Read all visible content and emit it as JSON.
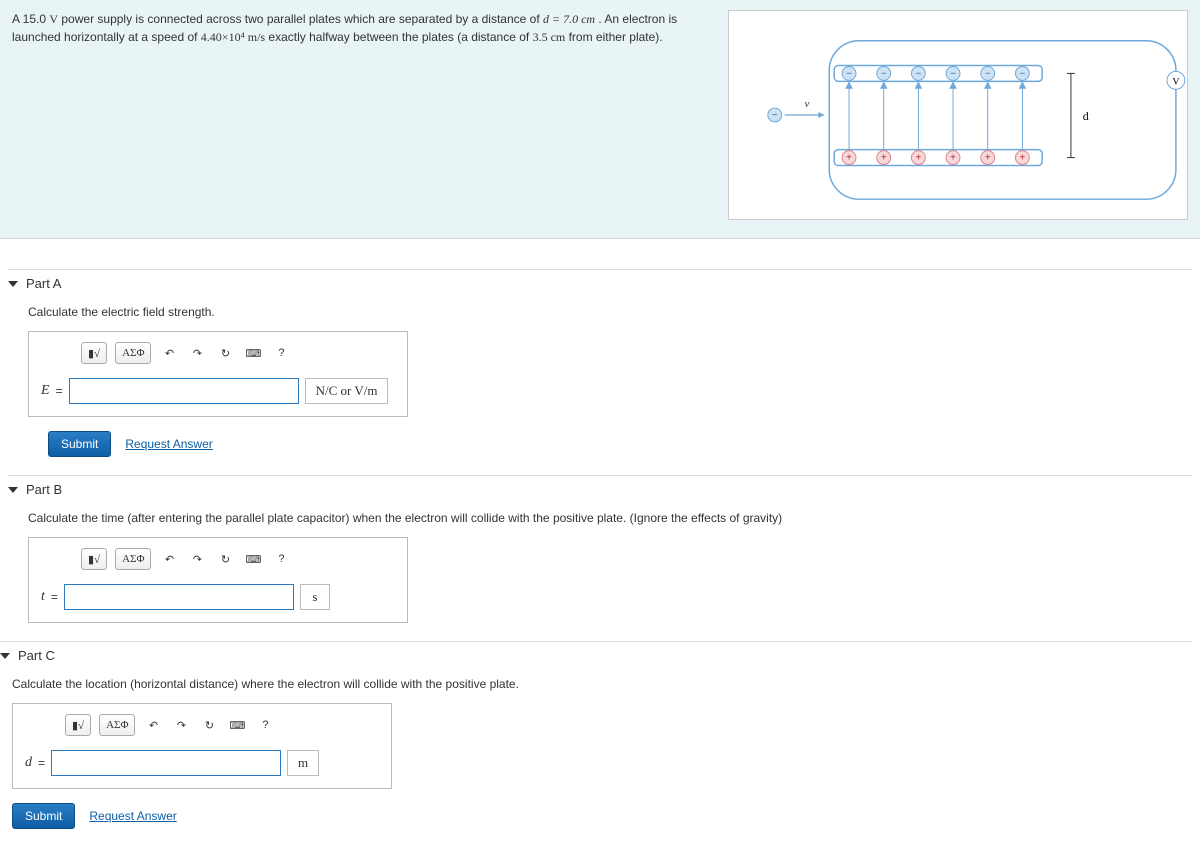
{
  "problem": {
    "text_prefix": "A 15.0 ",
    "unit_V": "V",
    "text_mid1": " power supply is connected across two parallel plates which are separated by a distance of ",
    "d_expr": "d = 7.0 cm",
    "text_mid2": " . An electron is launched horizontally at a speed of ",
    "speed": "4.40×10⁴ m/s",
    "text_mid3": " exactly halfway between the plates (a distance of ",
    "halfdist": "3.5 cm",
    "text_end": " from either plate)."
  },
  "diagram": {
    "v_label": "v",
    "d_label": "d",
    "V_label": "V",
    "minus": "−",
    "plus": "+"
  },
  "toolbar": {
    "templates_icon": "▮√",
    "greek": "ΑΣΦ",
    "undo": "↶",
    "redo": "↷",
    "reset": "↻",
    "keyboard": "⌨",
    "help": "?"
  },
  "partA": {
    "title": "Part A",
    "question": "Calculate the electric field strength.",
    "var": "E",
    "eq": " = ",
    "units": "N/C or V/m",
    "submit": "Submit",
    "request": "Request Answer"
  },
  "partB": {
    "title": "Part B",
    "question": "Calculate the time (after entering the parallel plate capacitor) when the electron will collide with the positive plate. (Ignore the effects of gravity)",
    "var": "t",
    "eq": " = ",
    "units": "s"
  },
  "partC": {
    "title": "Part C",
    "question": "Calculate the location (horizontal distance) where the electron will collide with the positive plate.",
    "var": "d",
    "eq": " = ",
    "units": "m",
    "submit": "Submit",
    "request": "Request Answer"
  }
}
